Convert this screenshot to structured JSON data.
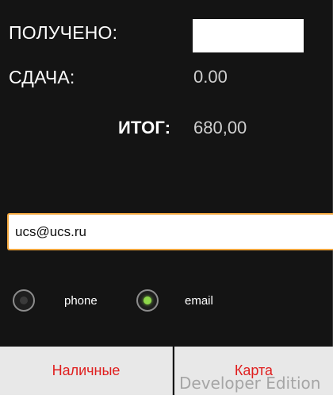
{
  "summary": {
    "received_label": "ПОЛУЧЕНО:",
    "received_value": "",
    "change_label": "СДАЧА:",
    "change_value": "0.00",
    "total_label": "ИТОГ:",
    "total_value": "680,00"
  },
  "contact": {
    "email_value": "ucs@ucs.ru",
    "options": [
      {
        "label": "phone",
        "checked": false
      },
      {
        "label": "email",
        "checked": true
      }
    ]
  },
  "payment": {
    "cash_label": "Наличные",
    "card_label": "Карта"
  },
  "watermark": "Developer Edition",
  "colors": {
    "background": "#141414",
    "accent_border": "#f0a53c",
    "radio_selected": "#8ed84a",
    "button_text": "#e01e1e",
    "button_bg": "#e8e8e8"
  }
}
